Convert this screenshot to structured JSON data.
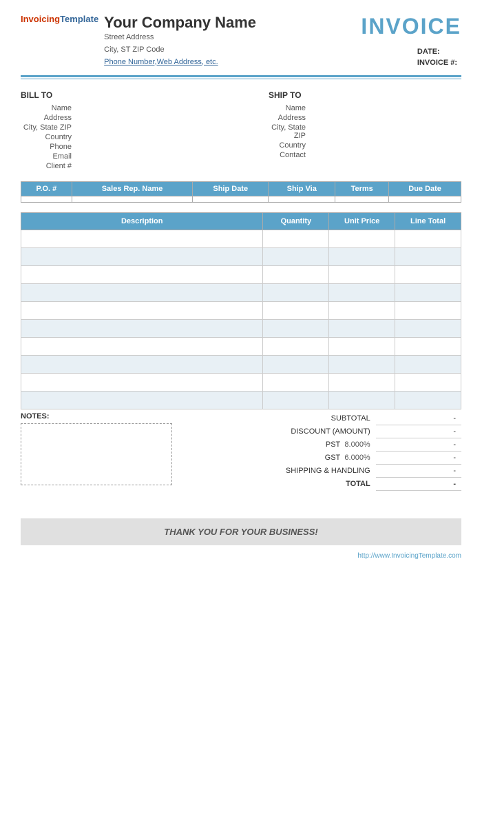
{
  "header": {
    "company_name": "Your Company Name",
    "street_address": "Street Address",
    "city_state_zip": "City, ST  ZIP Code",
    "contact_link": "Phone Number,Web Address, etc.",
    "invoice_title": "INVOICE",
    "date_label": "DATE:",
    "invoice_num_label": "INVOICE #:"
  },
  "logo": {
    "part1": "Invoicing",
    "part2": "Template"
  },
  "bill_to": {
    "heading": "BILL TO",
    "name_label": "Name",
    "address_label": "Address",
    "city_label": "City, State ZIP",
    "country_label": "Country",
    "phone_label": "Phone",
    "email_label": "Email",
    "client_label": "Client #"
  },
  "ship_to": {
    "heading": "SHIP TO",
    "name_label": "Name",
    "address_label": "Address",
    "city_label": "City, State ZIP",
    "country_label": "Country",
    "contact_label": "Contact"
  },
  "po_table": {
    "headers": [
      "P.O. #",
      "Sales Rep. Name",
      "Ship Date",
      "Ship Via",
      "Terms",
      "Due Date"
    ],
    "row": [
      "",
      "",
      "",
      "",
      "",
      ""
    ]
  },
  "items_table": {
    "headers": [
      "Description",
      "Quantity",
      "Unit Price",
      "Line Total"
    ],
    "rows": [
      [
        "",
        "",
        "",
        ""
      ],
      [
        "",
        "",
        "",
        ""
      ],
      [
        "",
        "",
        "",
        ""
      ],
      [
        "",
        "",
        "",
        ""
      ],
      [
        "",
        "",
        "",
        ""
      ],
      [
        "",
        "",
        "",
        ""
      ],
      [
        "",
        "",
        "",
        ""
      ],
      [
        "",
        "",
        "",
        ""
      ],
      [
        "",
        "",
        "",
        ""
      ],
      [
        "",
        "",
        "",
        ""
      ]
    ]
  },
  "totals": {
    "subtotal_label": "SUBTOTAL",
    "discount_label": "DISCOUNT (AMOUNT)",
    "pst_label": "PST",
    "pst_rate": "8.000%",
    "gst_label": "GST",
    "gst_rate": "6.000%",
    "shipping_label": "SHIPPING & HANDLING",
    "total_label": "TOTAL",
    "dash": "-"
  },
  "notes": {
    "label": "NOTES:"
  },
  "thank_you": {
    "message": "THANK YOU FOR YOUR BUSINESS!"
  },
  "footer": {
    "url": "http://www.InvoicingTemplate.com"
  }
}
